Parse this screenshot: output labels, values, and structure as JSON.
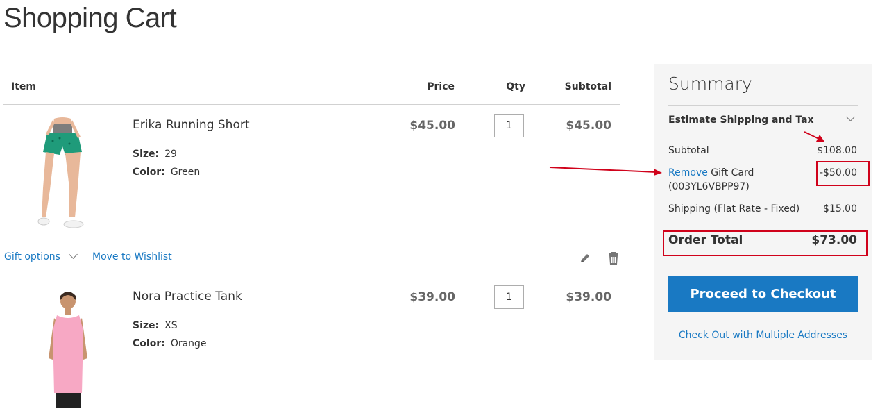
{
  "page": {
    "title": "Shopping Cart"
  },
  "table": {
    "headers": {
      "item": "Item",
      "price": "Price",
      "qty": "Qty",
      "subtotal": "Subtotal"
    },
    "items": [
      {
        "name": "Erika Running Short",
        "size_label": "Size:",
        "size": "29",
        "color_label": "Color:",
        "color": "Green",
        "price": "$45.00",
        "qty": "1",
        "subtotal": "$45.00"
      },
      {
        "name": "Nora Practice Tank",
        "size_label": "Size:",
        "size": "XS",
        "color_label": "Color:",
        "color": "Orange",
        "price": "$39.00",
        "qty": "1",
        "subtotal": "$39.00"
      }
    ],
    "actions": {
      "gift_options": "Gift options",
      "move_to_wishlist": "Move to Wishlist"
    }
  },
  "summary": {
    "title": "Summary",
    "estimate_label": "Estimate Shipping and Tax",
    "subtotal_label": "Subtotal",
    "subtotal_value": "$108.00",
    "gift_remove": "Remove",
    "gift_label": "Gift Card",
    "gift_code": "(003YL6VBPP97)",
    "gift_value": "-$50.00",
    "shipping_label": "Shipping (Flat Rate - Fixed)",
    "shipping_value": "$15.00",
    "order_total_label": "Order Total",
    "order_total_value": "$73.00",
    "checkout_button": "Proceed to Checkout",
    "multi_address_link": "Check Out with Multiple Addresses"
  },
  "colors": {
    "link": "#1979c3",
    "button": "#1979c3",
    "annotation": "#d0021b",
    "summary_bg": "#f5f5f5"
  }
}
